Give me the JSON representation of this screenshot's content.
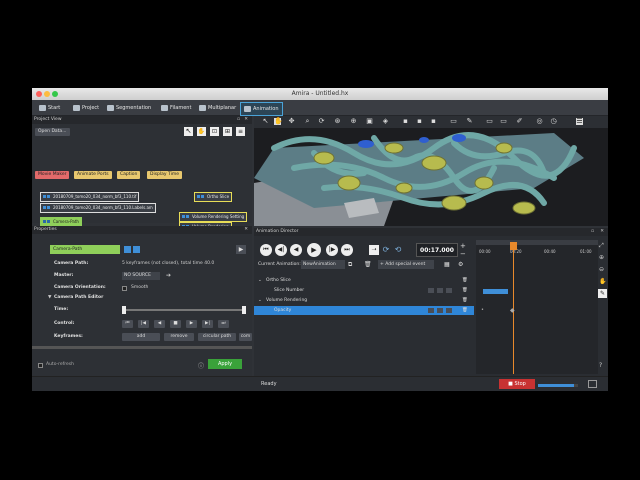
{
  "window": {
    "title": "Amira - Untitled.hx"
  },
  "toolbar": {
    "tabs": [
      {
        "label": "Start"
      },
      {
        "label": "Project"
      },
      {
        "label": "Segmentation"
      },
      {
        "label": "Filament"
      },
      {
        "label": "Multiplanar"
      },
      {
        "label": "Animation"
      }
    ]
  },
  "project_view": {
    "title": "Project View",
    "open_data": "Open Data...",
    "buttons": [
      "Movie Maker",
      "Animate Ports",
      "Caption",
      "Display Time"
    ],
    "nodes": {
      "data1": "20180709_tomo20_034_norm_bf3_110.tif",
      "data2": "20180709_tomo20_034_norm_bf3_110.Labels.am",
      "ortho": "Ortho Slice",
      "vrs": "Volume Rendering Setting",
      "vr": "Volume Rendering",
      "camera": "Camera-Path"
    }
  },
  "properties": {
    "title": "Properties",
    "module": "Camera-Path",
    "rows": {
      "camera_path_label": "Camera Path:",
      "camera_path_value": "5 keyframes (not closed), total time 40.0",
      "master_label": "Master:",
      "master_value": "NO SOURCE",
      "orientation_label": "Camera Orientation:",
      "orientation_value": "Smooth",
      "editor_label": "Camera Path Editor",
      "time_label": "Time:",
      "control_label": "Control:",
      "keyframes_label": "Keyframes:",
      "kf_add": "add",
      "kf_remove": "remove",
      "kf_circular": "circular path",
      "kf_com": "com"
    },
    "auto_refresh": "Auto-refresh",
    "apply": "Apply"
  },
  "animation_director": {
    "title": "Animation Director",
    "time": "00:17.000",
    "current_animation_label": "Current Animation:",
    "current_animation_value": "NewAnimation",
    "add_special_event": "Add special event",
    "ruler": [
      "00:00",
      "00:20",
      "00:40",
      "01:00"
    ],
    "tracks": {
      "ortho": "Ortho Slice",
      "slice_number": "Slice Number",
      "vr": "Volume Rendering",
      "opacity": "Opacity"
    }
  },
  "status": {
    "text": "Ready",
    "stop": "Stop"
  },
  "colors": {
    "accent": "#3f8fd8",
    "yellow_node": "#e8dd57",
    "stop_red": "#c83232",
    "apply_green": "#3aa23a"
  }
}
